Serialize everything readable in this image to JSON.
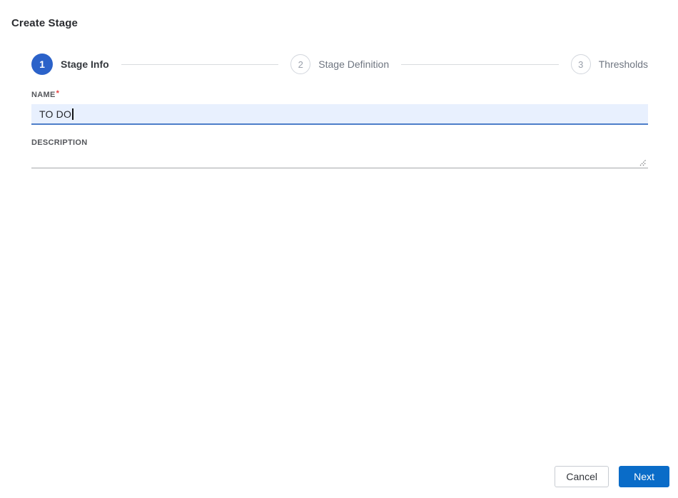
{
  "title": "Create Stage",
  "stepper": {
    "steps": [
      {
        "number": "1",
        "label": "Stage Info",
        "state": "active"
      },
      {
        "number": "2",
        "label": "Stage Definition",
        "state": "upcoming"
      },
      {
        "number": "3",
        "label": "Thresholds",
        "state": "upcoming"
      }
    ]
  },
  "form": {
    "name": {
      "label": "NAME",
      "required_marker": "*",
      "value": "TO DO"
    },
    "description": {
      "label": "DESCRIPTION",
      "value": ""
    }
  },
  "footer": {
    "cancel_label": "Cancel",
    "next_label": "Next"
  },
  "colors": {
    "step_active_blue": "#2b62c9",
    "next_button_blue": "#0a6cc8",
    "input_focus_bg": "#e8f0fe",
    "input_focus_border": "#4d7ec9",
    "required_red": "#e53e3e",
    "inactive_gray": "#6e7580"
  }
}
